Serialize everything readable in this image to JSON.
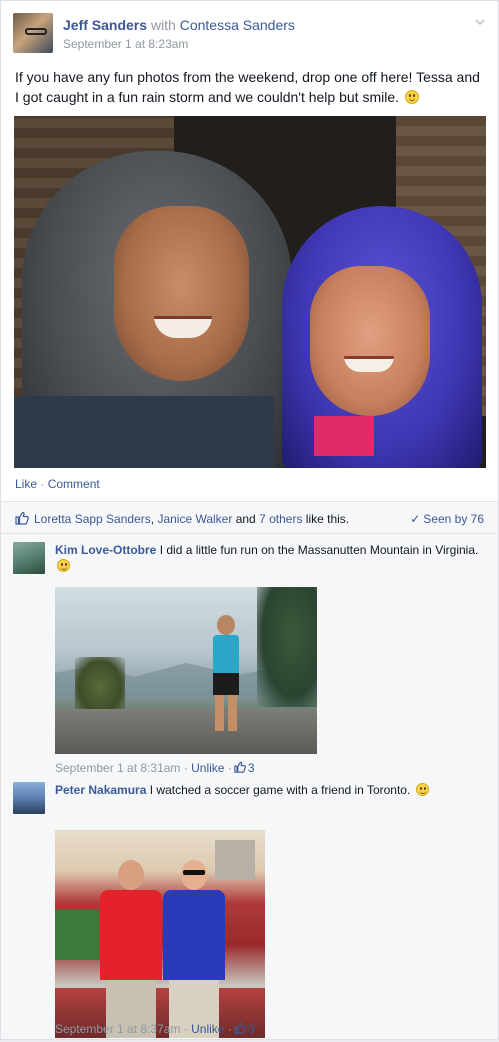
{
  "post": {
    "author": "Jeff Sanders",
    "with_text": "with",
    "with_name": "Contessa Sanders",
    "time": "September 1 at 8:23am",
    "text": "If you have any fun photos from the weekend, drop one off here! Tessa and I got caught in a fun rain storm and we couldn't help but smile.",
    "like_label": "Like",
    "separator": "·",
    "comment_label": "Comment"
  },
  "likes": {
    "name1": "Loretta Sapp Sanders",
    "comma": ",",
    "name2": "Janice Walker",
    "and_text": "and",
    "others": "7 others",
    "suffix": "like this.",
    "seen_by": "Seen by 76"
  },
  "comments": [
    {
      "author": "Kim Love-Ottobre",
      "text": "I did a little fun run on the Massanutten Mountain in Virginia.",
      "time": "September 1 at 8:31am",
      "separator": "·",
      "unlike_label": "Unlike",
      "like_count": "3"
    },
    {
      "author": "Peter Nakamura",
      "text": "I watched a soccer game with a friend in Toronto.",
      "time": "September 1 at 8:37am",
      "separator": "·",
      "unlike_label": "Unlike",
      "like_count": "3"
    }
  ],
  "colors": {
    "link": "#3b5998",
    "meta": "#9197a3",
    "bar_bg": "#f6f7f9"
  },
  "icons": {
    "menu": "chevron-down-icon",
    "like": "thumbs-up-icon",
    "seen": "check-icon",
    "emoji": "smiley-icon"
  }
}
